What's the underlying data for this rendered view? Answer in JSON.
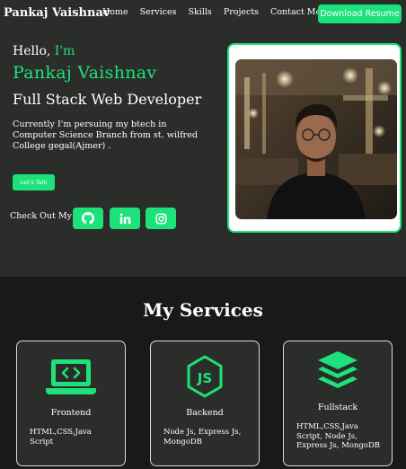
{
  "nav": {
    "logo": "Pankaj Vaishnav",
    "links": [
      "Home",
      "Services",
      "Skills",
      "Projects",
      "Contact Me"
    ],
    "download_label": "Download Resume"
  },
  "hero": {
    "hello": "Hello, ",
    "im": "I'm",
    "name": "Pankaj Vaishnav",
    "role": "Full Stack Web Developer",
    "description": "Currently I'm persuing my btech in Computer Science Branch from st. wilfred College gegal(Ajmer) .",
    "talk_label": "Let's Talk",
    "checkout_label": "Check Out My",
    "socials": [
      "github-icon",
      "linkedin-icon",
      "instagram-icon"
    ]
  },
  "services": {
    "title": "My Services",
    "cards": [
      {
        "icon": "laptop-code-icon",
        "title": "Frontend",
        "desc": "HTML,CSS,Java Script"
      },
      {
        "icon": "nodejs-icon",
        "title": "Backend",
        "desc": "Node Js, Express Js, MongoDB"
      },
      {
        "icon": "layers-icon",
        "title": "Fullstack",
        "desc": "HTML,CSS,Java Script, Node Js, Express Js, MongoDB"
      }
    ]
  },
  "colors": {
    "accent": "#1de27a",
    "hero_bg": "#2a2d2a",
    "page_bg": "#191919"
  }
}
